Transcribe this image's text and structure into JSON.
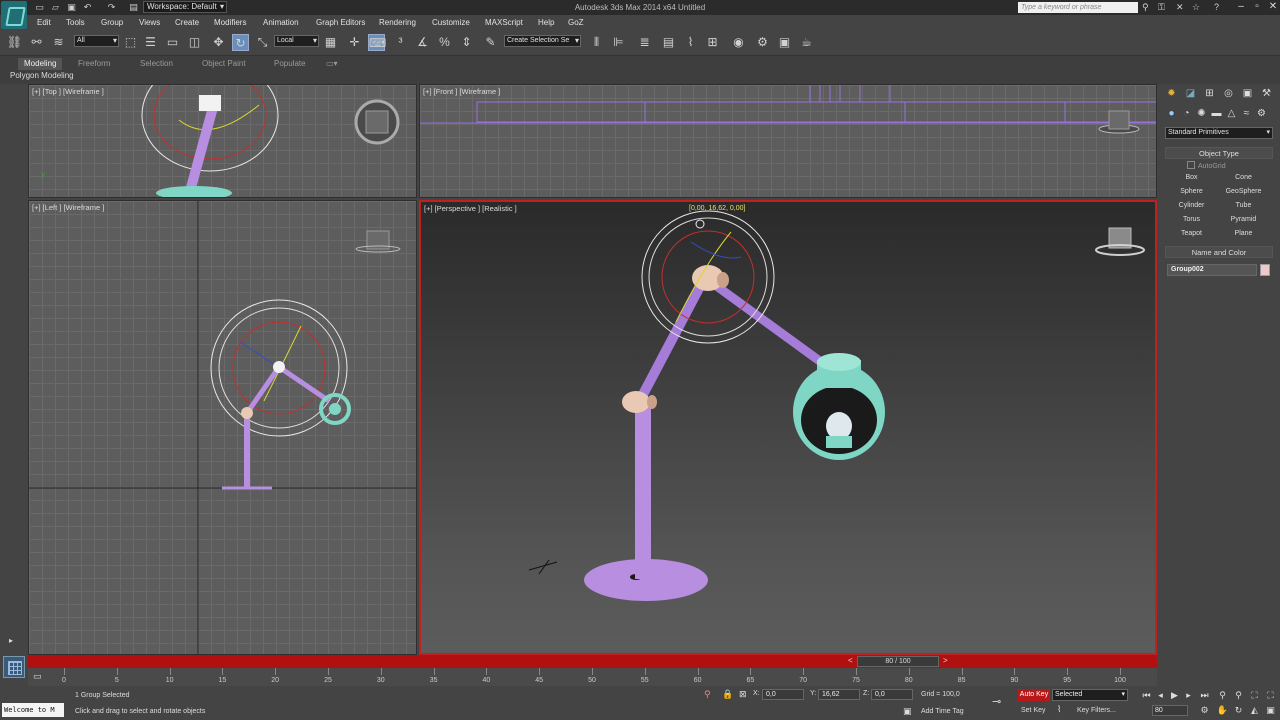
{
  "titlebar": {
    "workspace": "Workspace: Default",
    "title": "Autodesk 3ds Max  2014 x64      Untitled",
    "search_placeholder": "Type a keyword or phrase"
  },
  "menu": [
    "Edit",
    "Tools",
    "Group",
    "Views",
    "Create",
    "Modifiers",
    "Animation",
    "Graph Editors",
    "Rendering",
    "Customize",
    "MAXScript",
    "Help",
    "GoZ"
  ],
  "toolbar": {
    "filter_dropdown": "All",
    "reference_coord": "Local",
    "selection_set": "Create Selection Se"
  },
  "ribbon": {
    "tabs": [
      "Modeling",
      "Freeform",
      "Selection",
      "Object Paint",
      "Populate"
    ],
    "subpanel": "Polygon Modeling"
  },
  "viewports": {
    "top": "[+] [Top ] [Wireframe ]",
    "front": "[+] [Front ] [Wireframe ]",
    "left": "[+] [Left ] [Wireframe ]",
    "perspective": "[+] [Perspective ] [Realistic ]",
    "gizmo_readout": "[0,00, 16,62, 0,00]"
  },
  "command_panel": {
    "category": "Standard Primitives",
    "object_type_title": "Object Type",
    "autogrid": "AutoGrid",
    "buttons": [
      "Box",
      "Cone",
      "Sphere",
      "GeoSphere",
      "Cylinder",
      "Tube",
      "Torus",
      "Pyramid",
      "Teapot",
      "Plane"
    ],
    "name_color_title": "Name and Color",
    "object_name": "Group002",
    "object_color": "#f0c8c8"
  },
  "timeline": {
    "slider": "80 / 100",
    "ruler": [
      "0",
      "5",
      "10",
      "15",
      "20",
      "25",
      "30",
      "35",
      "40",
      "45",
      "50",
      "55",
      "60",
      "65",
      "70",
      "75",
      "80",
      "85",
      "90",
      "95",
      "100"
    ]
  },
  "status": {
    "maxscript": "Welcome to M",
    "selection": "1 Group Selected",
    "prompt": "Click and drag to select and rotate objects",
    "x_label": "X:",
    "x_value": "0,0",
    "y_label": "Y:",
    "y_value": "16,62",
    "z_label": "Z:",
    "z_value": "0,0",
    "grid": "Grid = 100,0",
    "add_time_tag": "Add Time Tag",
    "auto_key": "Auto Key",
    "set_key": "Set Key",
    "selected": "Selected",
    "key_filters": "Key Filters...",
    "frame": "80"
  },
  "colors": {
    "lamp": "#b78ee0",
    "shade": "#7fd6c4",
    "joint": "#e9c8b4",
    "active_border": "#c02020"
  }
}
